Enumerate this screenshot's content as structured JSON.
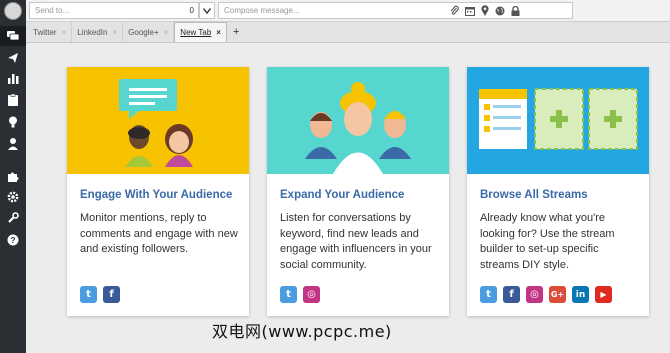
{
  "compose_bar": {
    "send_to_placeholder": "Send to...",
    "send_to_count": "0",
    "compose_placeholder": "Compose message..."
  },
  "tabs": [
    {
      "label": "Twitter"
    },
    {
      "label": "LinkedIn"
    },
    {
      "label": "Google+"
    },
    {
      "label": "New Tab",
      "active": true
    }
  ],
  "add_tab_label": "+",
  "tab_close_label": "×",
  "cards": [
    {
      "title": "Engage With Your Audience",
      "description": "Monitor mentions, reply to comments and engage with new and existing followers.",
      "hero_color": "#f7c200",
      "socials": [
        "twitter",
        "facebook"
      ]
    },
    {
      "title": "Expand Your Audience",
      "description": "Listen for conversations by keyword, find new leads and engage with influencers in your social community.",
      "hero_color": "#57d6cf",
      "socials": [
        "twitter",
        "instagram"
      ]
    },
    {
      "title": "Browse All Streams",
      "description": "Already know what you're looking for? Use the stream builder to set-up specific streams DIY style.",
      "hero_color": "#24a6e2",
      "socials": [
        "twitter",
        "facebook",
        "instagram",
        "google-plus",
        "linkedin",
        "youtube"
      ]
    }
  ],
  "social_glyphs": {
    "twitter": "t",
    "facebook": "f",
    "instagram": "◎",
    "google-plus": "G+",
    "linkedin": "in",
    "youtube": "▶"
  },
  "colors": {
    "twitter": "#4a9de0",
    "facebook": "#3b5a9a",
    "instagram": "#c13584",
    "google-plus": "#dd4b39",
    "linkedin": "#0a77b5",
    "youtube": "#e02a20",
    "rail": "#2b2f33",
    "title_blue": "#3a6aa8"
  },
  "watermark": "双电网(www.pcpc.me)"
}
